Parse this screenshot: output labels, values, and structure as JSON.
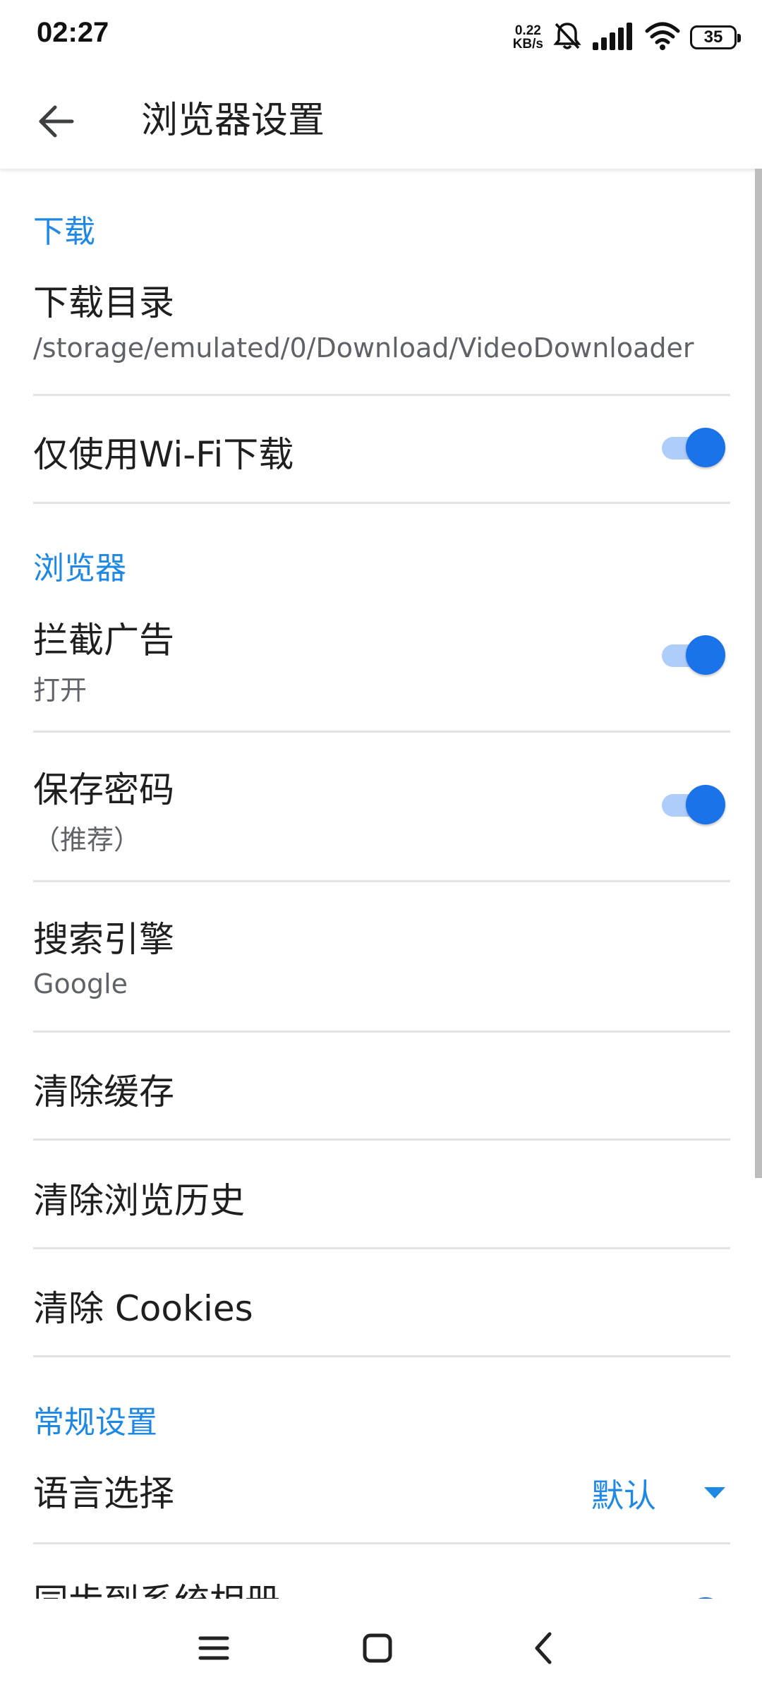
{
  "status_bar": {
    "time": "02:27",
    "net_speed_value": "0.22",
    "net_speed_unit": "KB/s",
    "battery": "35",
    "icons": [
      "bell-off-icon",
      "signal-icon",
      "wifi-icon",
      "battery-icon"
    ]
  },
  "app_bar": {
    "title": "浏览器设置",
    "back_icon": "arrow-left-icon"
  },
  "sections": {
    "download": {
      "header": "下载",
      "dir_title": "下载目录",
      "dir_value": "/storage/emulated/0/Download/VideoDownloader",
      "wifi_only_title": "仅使用Wi-Fi下载",
      "wifi_only_on": true
    },
    "browser": {
      "header": "浏览器",
      "adblock_title": "拦截广告",
      "adblock_sub": "打开",
      "adblock_on": true,
      "save_pw_title": "保存密码",
      "save_pw_sub": "（推荐）",
      "save_pw_on": true,
      "search_title": "搜索引擎",
      "search_value": "Google",
      "clear_cache": "清除缓存",
      "clear_history": "清除浏览历史",
      "clear_cookies": "清除 Cookies"
    },
    "general": {
      "header": "常规设置",
      "language_title": "语言选择",
      "language_value": "默认",
      "sync_album_title": "同步到系统相册"
    }
  },
  "colors": {
    "accent": "#1e88e5",
    "switch_thumb": "#1a73e8",
    "switch_track": "#aecdf8"
  },
  "nav_bar": {
    "icons": [
      "menu-icon",
      "home-square-icon",
      "back-chevron-icon"
    ]
  }
}
